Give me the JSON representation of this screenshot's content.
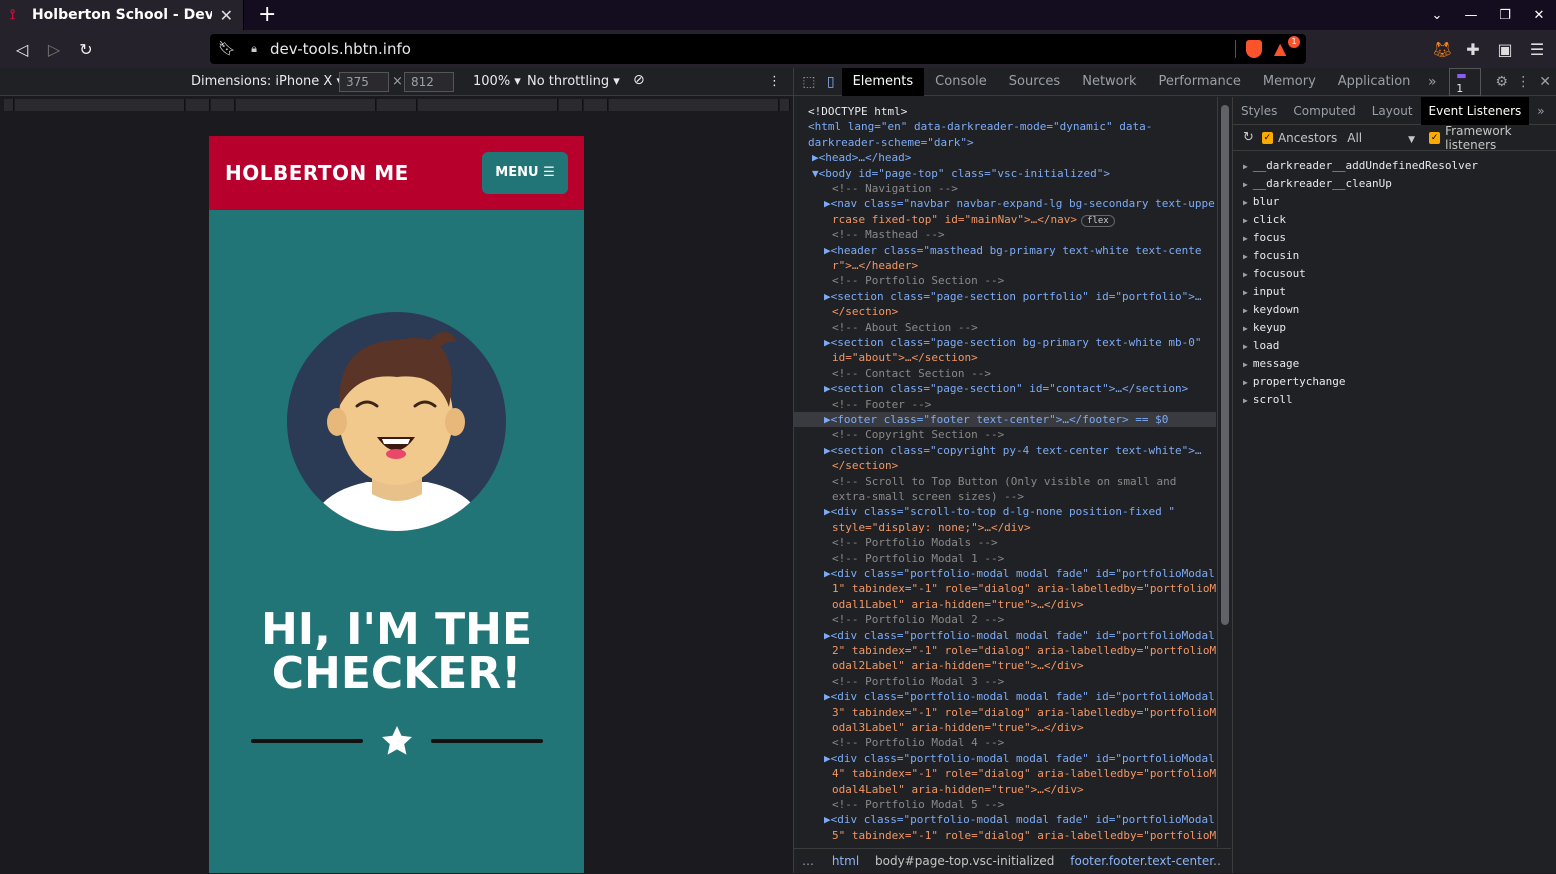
{
  "browser": {
    "tab_title": "Holberton School - Develo",
    "url": "dev-tools.hbtn.info",
    "notification_count": "1"
  },
  "device_toolbar": {
    "dimensions_label": "Dimensions: iPhone X",
    "width": "375",
    "times": "×",
    "height": "812",
    "zoom": "100%",
    "throttling": "No throttling"
  },
  "page": {
    "brand": "HOLBERTON ME",
    "menu_label": "MENU",
    "headline_line1": "HI, I'M THE",
    "headline_line2": "CHECKER!"
  },
  "devtools": {
    "tabs": [
      "Elements",
      "Console",
      "Sources",
      "Network",
      "Performance",
      "Memory",
      "Application"
    ],
    "issues_count": "1",
    "dom_lines": [
      {
        "kind": "plain",
        "text": "<!DOCTYPE html>"
      },
      {
        "kind": "html1",
        "text": "<html lang=\"en\" data-darkreader-mode=\"dynamic\" data-"
      },
      {
        "kind": "html2",
        "text": "darkreader-scheme=\"dark\">"
      },
      {
        "kind": "head",
        "text": "▶<head>…</head>"
      },
      {
        "kind": "body",
        "text": "▼<body id=\"page-top\" class=\"vsc-initialized\">"
      },
      {
        "kind": "comment",
        "text": "<!-- Navigation -->"
      },
      {
        "kind": "node",
        "text": "▶<nav class=\"navbar navbar-expand-lg bg-secondary text-uppe"
      },
      {
        "kind": "cont",
        "text": "rcase fixed-top\" id=\"mainNav\">…</nav>"
      },
      {
        "kind": "comment",
        "text": "<!-- Masthead -->"
      },
      {
        "kind": "node",
        "text": "▶<header class=\"masthead bg-primary text-white text-cente"
      },
      {
        "kind": "cont",
        "text": "r\">…</header>"
      },
      {
        "kind": "comment",
        "text": "<!-- Portfolio Section -->"
      },
      {
        "kind": "node",
        "text": "▶<section class=\"page-section portfolio\" id=\"portfolio\">…"
      },
      {
        "kind": "cont",
        "text": "</section>"
      },
      {
        "kind": "comment",
        "text": "<!-- About Section -->"
      },
      {
        "kind": "node",
        "text": "▶<section class=\"page-section bg-primary text-white mb-0\""
      },
      {
        "kind": "cont",
        "text": "id=\"about\">…</section>"
      },
      {
        "kind": "comment",
        "text": "<!-- Contact Section -->"
      },
      {
        "kind": "node",
        "text": "▶<section class=\"page-section\" id=\"contact\">…</section>"
      },
      {
        "kind": "comment",
        "text": "<!-- Footer -->"
      },
      {
        "kind": "selected",
        "text": "▶<footer class=\"footer text-center\">…</footer> == $0"
      },
      {
        "kind": "comment",
        "text": "<!-- Copyright Section -->"
      },
      {
        "kind": "node",
        "text": "▶<section class=\"copyright py-4 text-center text-white\">…"
      },
      {
        "kind": "cont",
        "text": "</section>"
      },
      {
        "kind": "comment",
        "text": "<!-- Scroll to Top Button (Only visible on small and"
      },
      {
        "kind": "comment2",
        "text": "extra-small screen sizes) -->"
      },
      {
        "kind": "node",
        "text": "▶<div class=\"scroll-to-top d-lg-none position-fixed \""
      },
      {
        "kind": "cont",
        "text": "style=\"display: none;\">…</div>"
      },
      {
        "kind": "comment",
        "text": "<!-- Portfolio Modals -->"
      },
      {
        "kind": "comment",
        "text": "<!-- Portfolio Modal 1 -->"
      },
      {
        "kind": "node",
        "text": "▶<div class=\"portfolio-modal modal fade\" id=\"portfolioModal"
      },
      {
        "kind": "cont",
        "text": "1\" tabindex=\"-1\" role=\"dialog\" aria-labelledby=\"portfolioM"
      },
      {
        "kind": "cont",
        "text": "odal1Label\" aria-hidden=\"true\">…</div>"
      },
      {
        "kind": "comment",
        "text": "<!-- Portfolio Modal 2 -->"
      },
      {
        "kind": "node",
        "text": "▶<div class=\"portfolio-modal modal fade\" id=\"portfolioModal"
      },
      {
        "kind": "cont",
        "text": "2\" tabindex=\"-1\" role=\"dialog\" aria-labelledby=\"portfolioM"
      },
      {
        "kind": "cont",
        "text": "odal2Label\" aria-hidden=\"true\">…</div>"
      },
      {
        "kind": "comment",
        "text": "<!-- Portfolio Modal 3 -->"
      },
      {
        "kind": "node",
        "text": "▶<div class=\"portfolio-modal modal fade\" id=\"portfolioModal"
      },
      {
        "kind": "cont",
        "text": "3\" tabindex=\"-1\" role=\"dialog\" aria-labelledby=\"portfolioM"
      },
      {
        "kind": "cont",
        "text": "odal3Label\" aria-hidden=\"true\">…</div>"
      },
      {
        "kind": "comment",
        "text": "<!-- Portfolio Modal 4 -->"
      },
      {
        "kind": "node",
        "text": "▶<div class=\"portfolio-modal modal fade\" id=\"portfolioModal"
      },
      {
        "kind": "cont",
        "text": "4\" tabindex=\"-1\" role=\"dialog\" aria-labelledby=\"portfolioM"
      },
      {
        "kind": "cont",
        "text": "odal4Label\" aria-hidden=\"true\">…</div>"
      },
      {
        "kind": "comment",
        "text": "<!-- Portfolio Modal 5 -->"
      },
      {
        "kind": "node",
        "text": "▶<div class=\"portfolio-modal modal fade\" id=\"portfolioModal"
      },
      {
        "kind": "cont",
        "text": "5\" tabindex=\"-1\" role=\"dialog\" aria-labelledby=\"portfolioM"
      }
    ],
    "flex_badge": "flex",
    "breadcrumbs": [
      "html",
      "body#page-top.vsc-initialized",
      "footer.footer.text-center"
    ],
    "side_tabs": [
      "Styles",
      "Computed",
      "Layout",
      "Event Listeners"
    ],
    "ancestors_label": "Ancestors",
    "all_label": "All",
    "framework_label": "Framework listeners",
    "events": [
      "__darkreader__addUndefinedResolver",
      "__darkreader__cleanUp",
      "blur",
      "click",
      "focus",
      "focusin",
      "focusout",
      "input",
      "keydown",
      "keyup",
      "load",
      "message",
      "propertychange",
      "scroll"
    ]
  },
  "colors": {
    "navbar": "#b8002c",
    "primary": "#227577",
    "avatar_bg": "#2b3a55"
  }
}
